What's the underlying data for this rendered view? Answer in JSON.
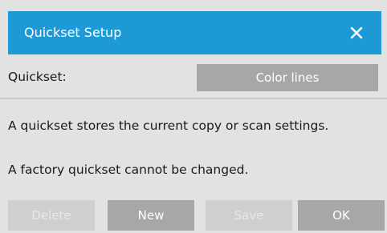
{
  "dialog": {
    "title": "Quickset Setup",
    "close_icon": "close-icon"
  },
  "quickset": {
    "label": "Quickset:",
    "selected": "Color lines"
  },
  "messages": {
    "line1": "A quickset stores the current copy or scan settings.",
    "line2": "A factory quickset cannot be changed."
  },
  "buttons": {
    "delete": {
      "label": "Delete",
      "enabled": false
    },
    "new": {
      "label": "New",
      "enabled": true
    },
    "save": {
      "label": "Save",
      "enabled": false
    },
    "ok": {
      "label": "OK",
      "enabled": true
    }
  },
  "colors": {
    "titlebar": "#1d9ad6",
    "background": "#e2e2e2",
    "button_active": "#a7a7a7",
    "button_disabled": "#cfcfcf"
  }
}
